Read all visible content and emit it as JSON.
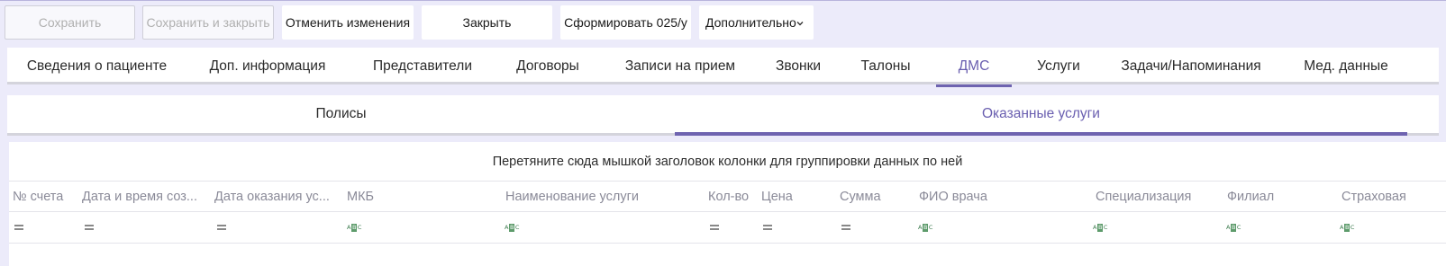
{
  "toolbar": {
    "save": "Сохранить",
    "save_close": "Сохранить и закрыть",
    "cancel_changes": "Отменить изменения",
    "close": "Закрыть",
    "form_025": "Сформировать 025/у",
    "more": "Дополнительно"
  },
  "main_tabs": [
    "Сведения о пациенте",
    "Доп. информация",
    "Представители",
    "Договоры",
    "Записи на прием",
    "Звонки",
    "Талоны",
    "ДМС",
    "Услуги",
    "Задачи/Напоминания",
    "Мед. данные"
  ],
  "active_main_tab": "ДМС",
  "sub_tabs": [
    "Полисы",
    "Оказанные услуги"
  ],
  "active_sub_tab": "Оказанные услуги",
  "grid": {
    "group_hint": "Перетяните сюда мышкой заголовок колонки для группировки данных по ней",
    "columns": [
      {
        "label": "№ счета",
        "filter": "equals"
      },
      {
        "label": "Дата и время соз...",
        "filter": "equals"
      },
      {
        "label": "Дата оказания ус...",
        "filter": "equals"
      },
      {
        "label": "МКБ",
        "filter": "text"
      },
      {
        "label": "Наименование услуги",
        "filter": "text"
      },
      {
        "label": "Кол-во",
        "filter": "equals"
      },
      {
        "label": "Цена",
        "filter": "equals"
      },
      {
        "label": "Сумма",
        "filter": "equals"
      },
      {
        "label": "ФИО врача",
        "filter": "text"
      },
      {
        "label": "Специализация",
        "filter": "text"
      },
      {
        "label": "Филиал",
        "filter": "text"
      },
      {
        "label": "Страховая",
        "filter": "text"
      }
    ]
  },
  "colors": {
    "accent": "#6e63b0",
    "background": "#ecebfa",
    "header_text": "#8a8a98"
  }
}
